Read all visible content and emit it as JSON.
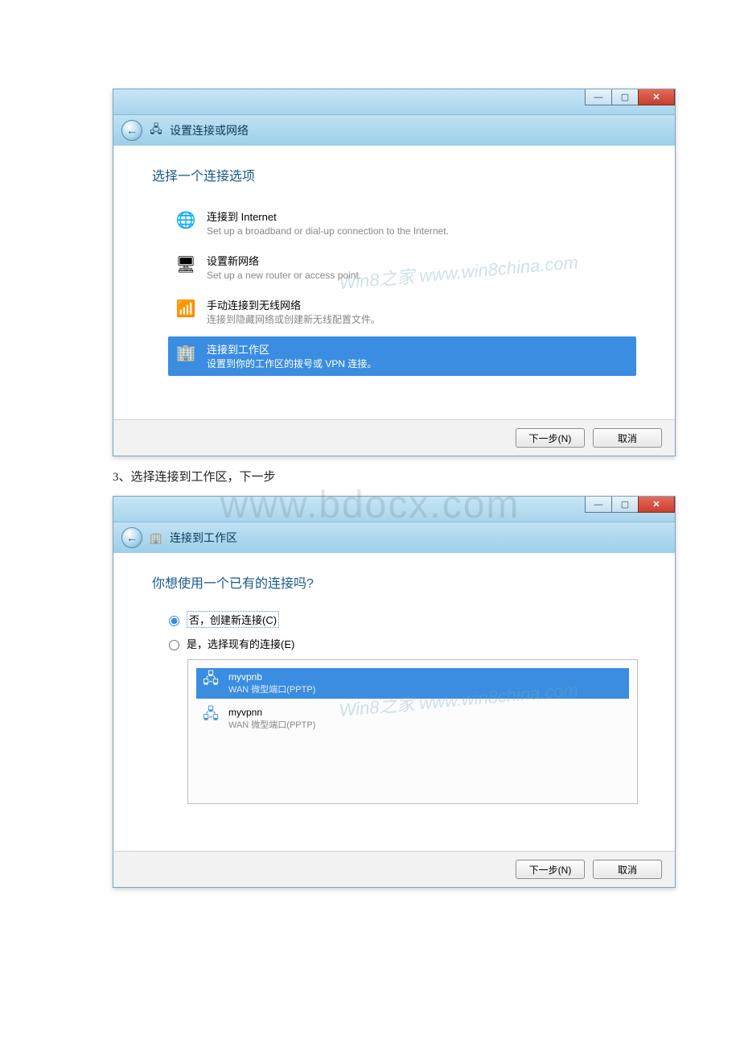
{
  "watermark_big": "www.bdocx.com",
  "watermark_small_1": "Win8之家 www.win8china.com",
  "watermark_small_2": "Win8之家 www.win8china.com",
  "step_text": "3、选择连接到工作区，下一步",
  "window1": {
    "btn_min_glyph": "—",
    "btn_max_glyph": "▢",
    "btn_close_glyph": "✕",
    "back_glyph": "←",
    "nav_title": "设置连接或网络",
    "heading": "选择一个连接选项",
    "options": [
      {
        "icon": "🌐",
        "title": "连接到 Internet",
        "desc": "Set up a broadband or dial-up connection to the Internet."
      },
      {
        "icon": "🖥",
        "title": "设置新网络",
        "desc": "Set up a new router or access point."
      },
      {
        "icon": "📶",
        "title": "手动连接到无线网络",
        "desc": "连接到隐藏网络或创建新无线配置文件。"
      },
      {
        "icon": "🏢",
        "title": "连接到工作区",
        "desc": "设置到你的工作区的拨号或 VPN 连接。"
      }
    ],
    "next_label": "下一步(N)",
    "cancel_label": "取消"
  },
  "window2": {
    "btn_min_glyph": "—",
    "btn_max_glyph": "▢",
    "btn_close_glyph": "✕",
    "back_glyph": "←",
    "nav_title": "连接到工作区",
    "heading": "你想使用一个已有的连接吗?",
    "radio_no": "否，创建新连接(C)",
    "radio_yes": "是，选择现有的连接(E)",
    "connections": [
      {
        "icon": "🖧",
        "title": "myvpnb",
        "sub": "WAN 微型端口(PPTP)"
      },
      {
        "icon": "🖧",
        "title": "myvpnn",
        "sub": "WAN 微型端口(PPTP)"
      }
    ],
    "next_label": "下一步(N)",
    "cancel_label": "取消"
  }
}
